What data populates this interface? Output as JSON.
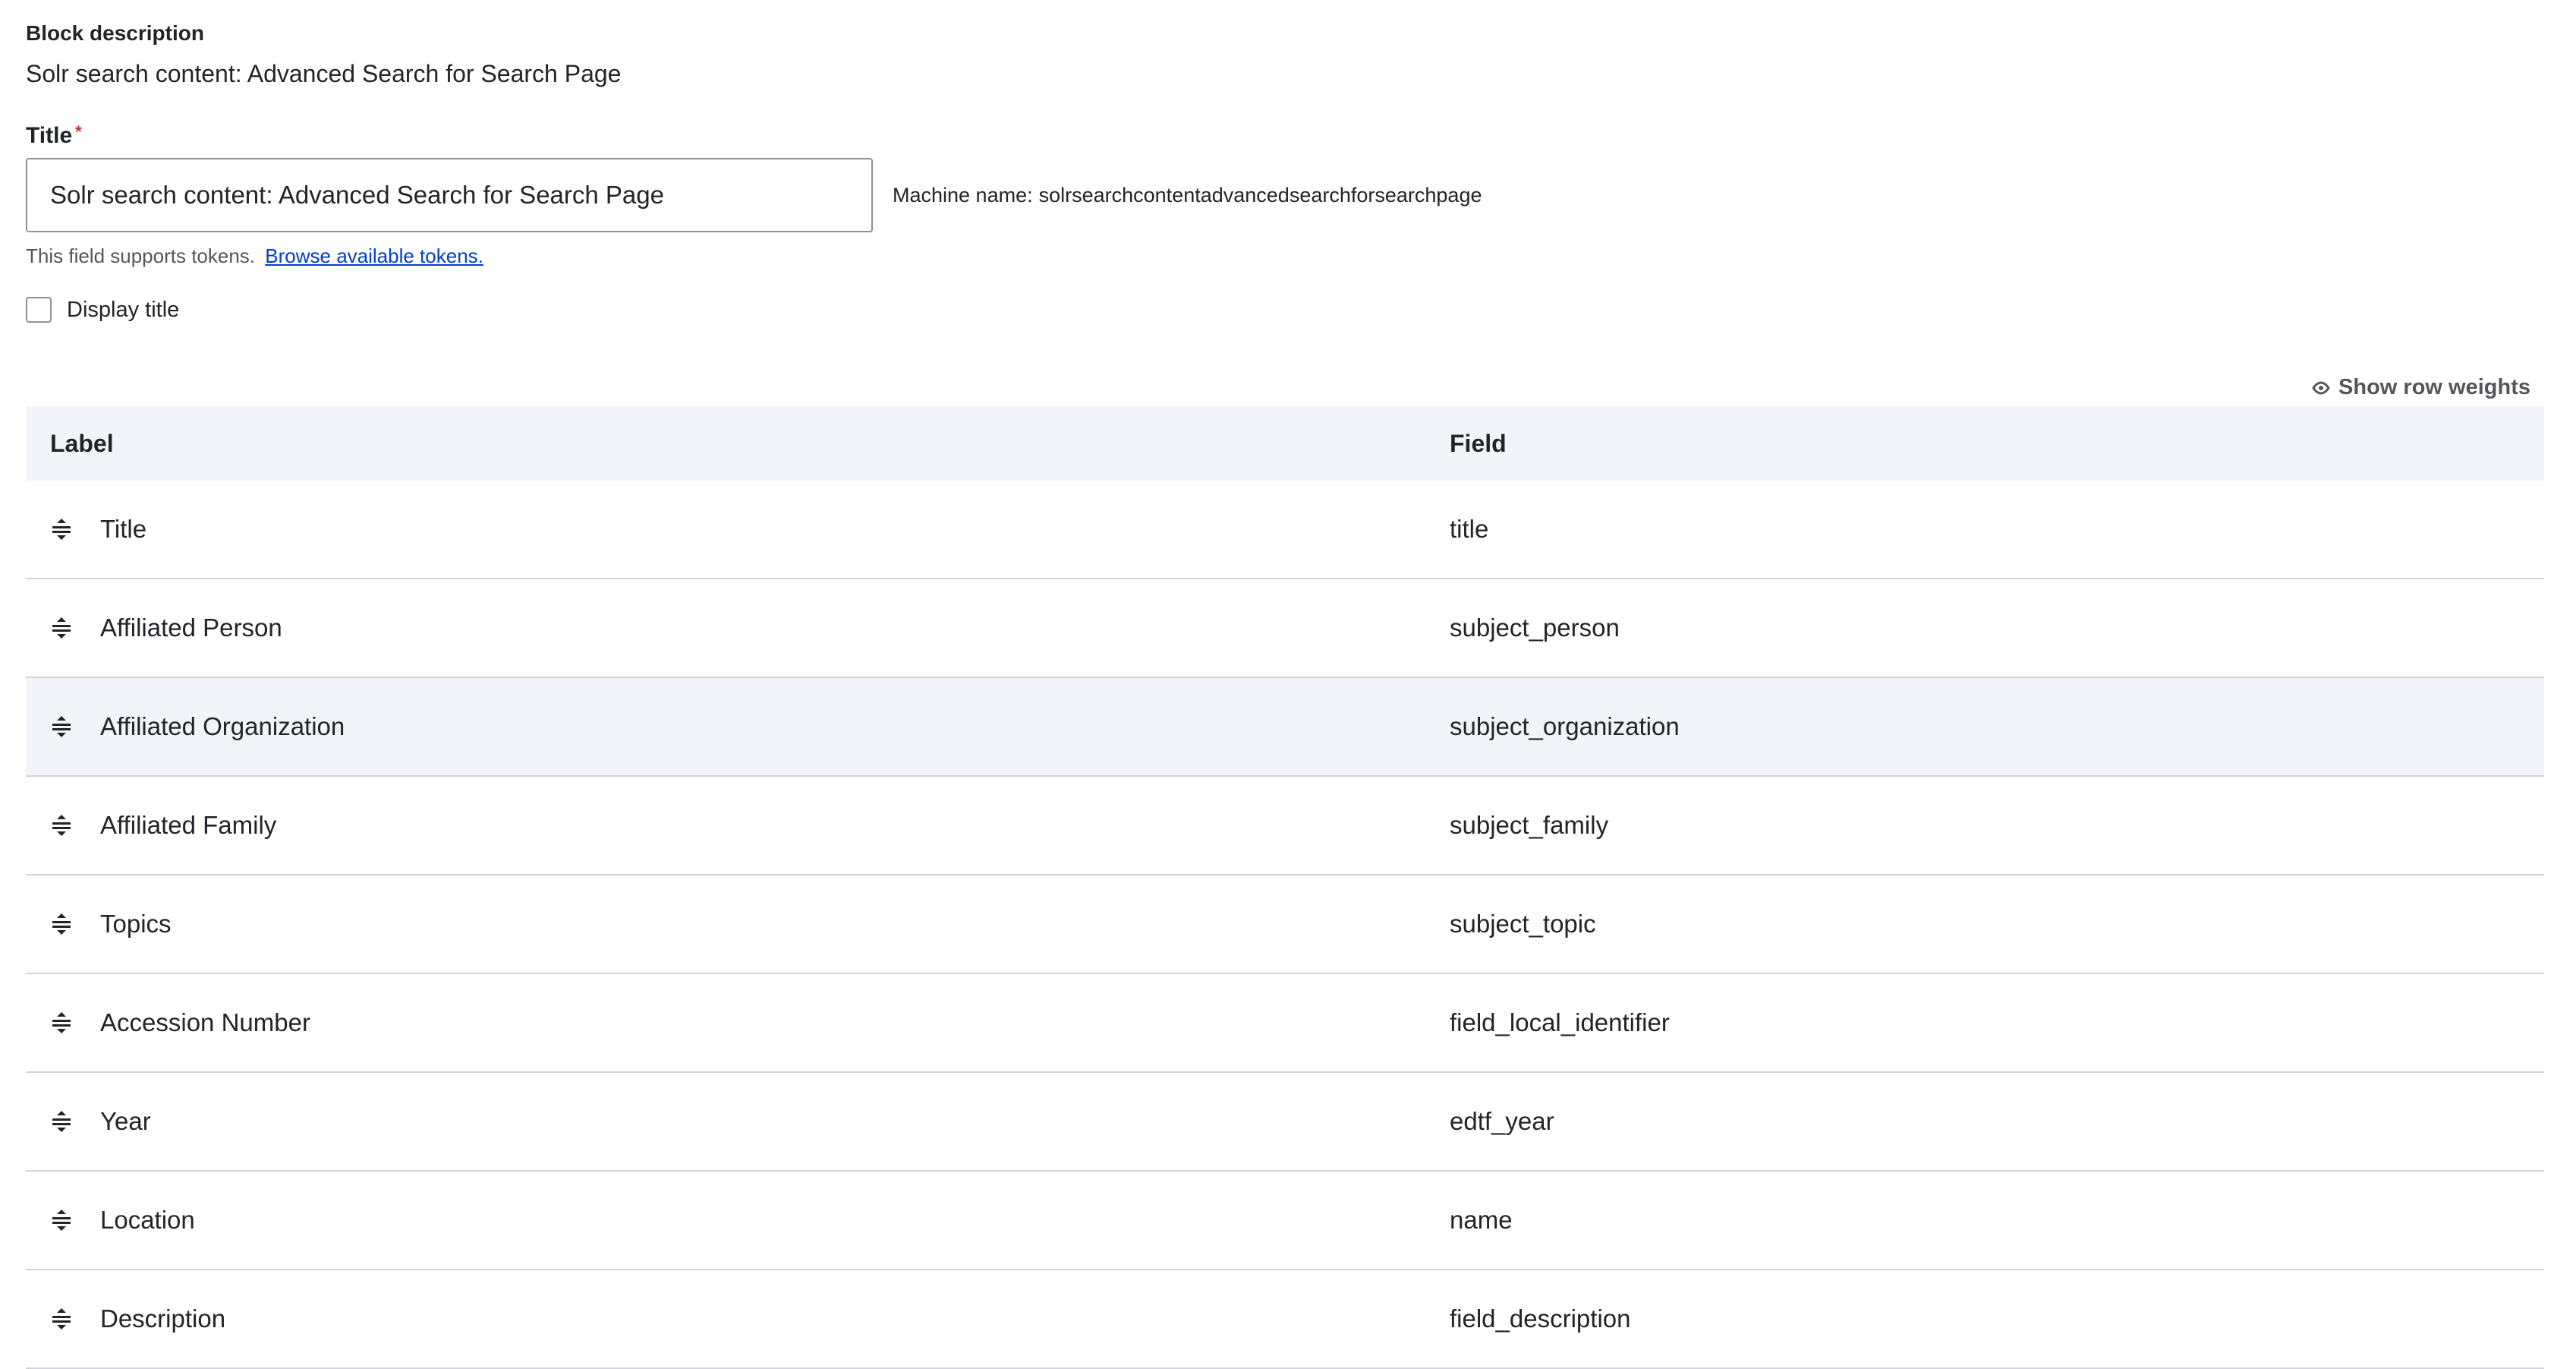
{
  "block_description": {
    "label": "Block description",
    "value": "Solr search content: Advanced Search for Search Page"
  },
  "title_field": {
    "label": "Title",
    "required_mark": "*",
    "value": "Solr search content: Advanced Search for Search Page",
    "machine_name_label": "Machine name:",
    "machine_name_value": "solrsearchcontentadvancedsearchforsearchpage",
    "tokens_text": "This field supports tokens.",
    "tokens_link": "Browse available tokens."
  },
  "display_title": {
    "label": "Display title",
    "checked": false
  },
  "row_weights": {
    "label": "Show row weights",
    "icon": "eye-icon"
  },
  "table": {
    "headers": {
      "label": "Label",
      "field": "Field"
    },
    "rows": [
      {
        "label": "Title",
        "field": "title"
      },
      {
        "label": "Affiliated Person",
        "field": "subject_person"
      },
      {
        "label": "Affiliated Organization",
        "field": "subject_organization"
      },
      {
        "label": "Affiliated Family",
        "field": "subject_family"
      },
      {
        "label": "Topics",
        "field": "subject_topic"
      },
      {
        "label": "Accession Number",
        "field": "field_local_identifier"
      },
      {
        "label": "Year",
        "field": "edtf_year"
      },
      {
        "label": "Location",
        "field": "name"
      },
      {
        "label": "Description",
        "field": "field_description"
      }
    ]
  },
  "colors": {
    "text": "#232429",
    "link": "#003ecc",
    "required": "#d72222",
    "header_bg": "#f3f4f9",
    "border": "#d3d4d9"
  }
}
